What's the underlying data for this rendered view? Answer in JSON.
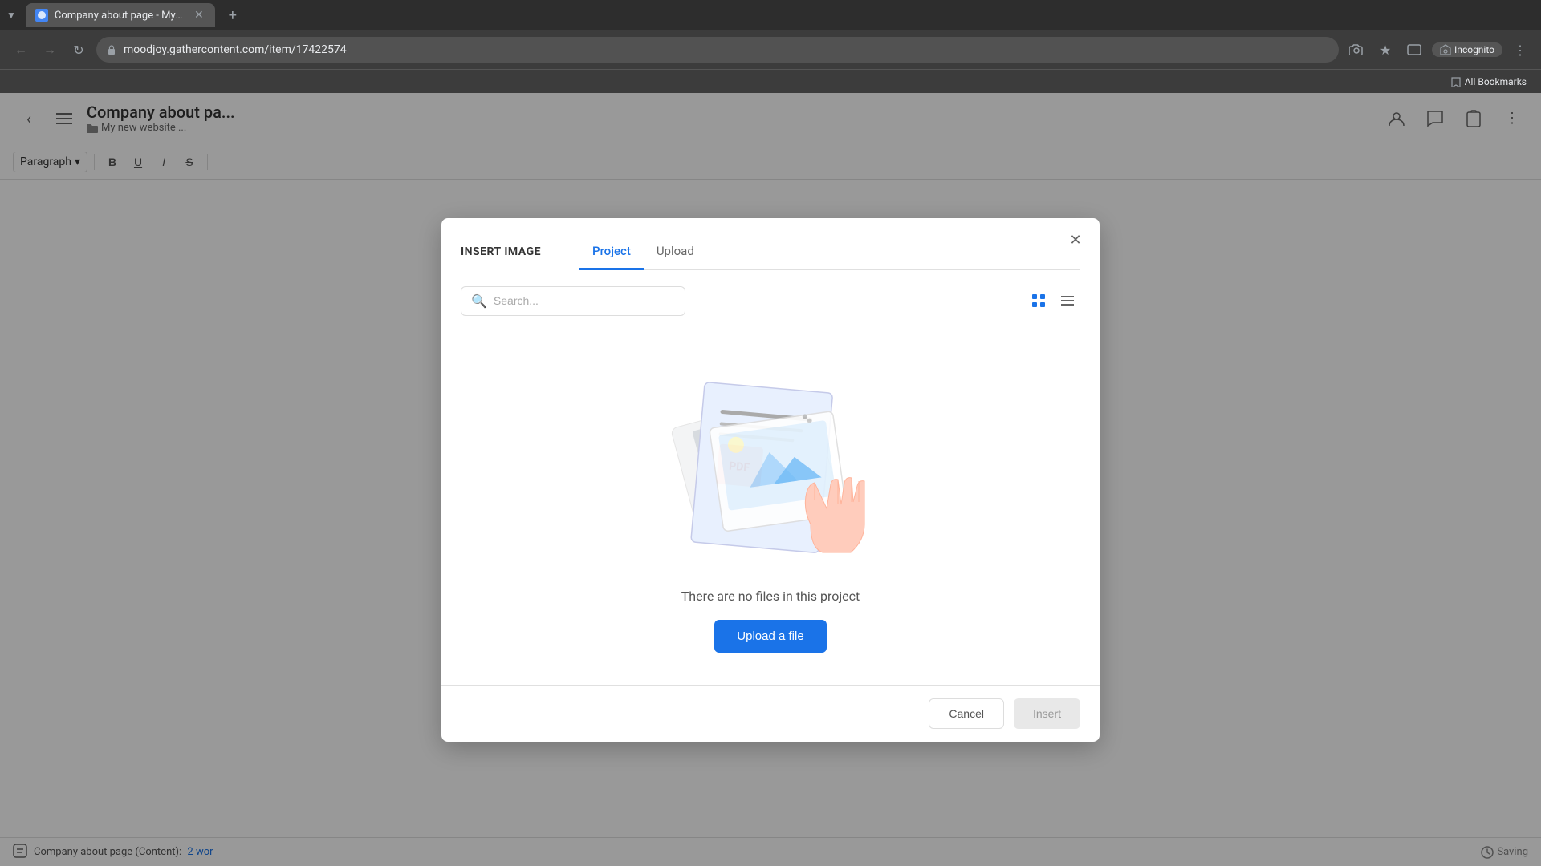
{
  "browser": {
    "tab_title": "Company about page - My ne...",
    "tab_favicon": "blue",
    "url": "moodjoy.gathercontent.com/item/17422574",
    "new_tab_label": "+",
    "incognito_label": "Incognito",
    "bookmarks_label": "All Bookmarks"
  },
  "app": {
    "page_title": "Company about pa...",
    "breadcrumb_text": "My new website ...",
    "status_text": "Company about page (Content):",
    "status_count": "2 wor",
    "saving_text": "Saving"
  },
  "editor": {
    "paragraph_label": "Paragraph",
    "dropdown_arrow": "▾"
  },
  "modal": {
    "title": "INSERT IMAGE",
    "close_label": "✕",
    "tab_project": "Project",
    "tab_upload": "Upload",
    "search_placeholder": "Search...",
    "empty_text": "There are no files in this project",
    "upload_btn_label": "Upload a file",
    "cancel_btn_label": "Cancel",
    "insert_btn_label": "Insert"
  }
}
